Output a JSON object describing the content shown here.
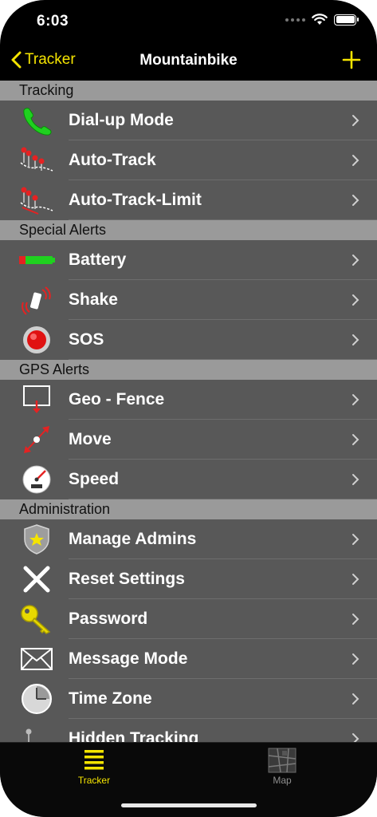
{
  "status_bar": {
    "time": "6:03"
  },
  "navbar": {
    "back_label": "Tracker",
    "title": "Mountainbike"
  },
  "sections": [
    {
      "header": "Tracking",
      "items": [
        {
          "label": "Dial-up Mode",
          "icon": "phone-icon"
        },
        {
          "label": "Auto-Track",
          "icon": "track-pins-icon"
        },
        {
          "label": "Auto-Track-Limit",
          "icon": "track-limit-icon"
        }
      ]
    },
    {
      "header": "Special Alerts",
      "items": [
        {
          "label": "Battery",
          "icon": "battery-icon"
        },
        {
          "label": "Shake",
          "icon": "shake-icon"
        },
        {
          "label": "SOS",
          "icon": "sos-icon"
        }
      ]
    },
    {
      "header": "GPS Alerts",
      "items": [
        {
          "label": "Geo - Fence",
          "icon": "geofence-icon"
        },
        {
          "label": "Move",
          "icon": "move-icon"
        },
        {
          "label": "Speed",
          "icon": "speedometer-icon"
        }
      ]
    },
    {
      "header": "Administration",
      "items": [
        {
          "label": "Manage Admins",
          "icon": "badge-icon"
        },
        {
          "label": "Reset Settings",
          "icon": "x-icon"
        },
        {
          "label": "Password",
          "icon": "key-icon"
        },
        {
          "label": "Message Mode",
          "icon": "envelope-icon"
        },
        {
          "label": "Time Zone",
          "icon": "clock-icon"
        },
        {
          "label": "Hidden Tracking",
          "icon": "hidden-pin-icon"
        }
      ]
    }
  ],
  "tabbar": {
    "tracker_label": "Tracker",
    "map_label": "Map"
  },
  "colors": {
    "accent": "#f5e400",
    "row_bg": "#585858",
    "header_bg": "#9a9a9a"
  }
}
